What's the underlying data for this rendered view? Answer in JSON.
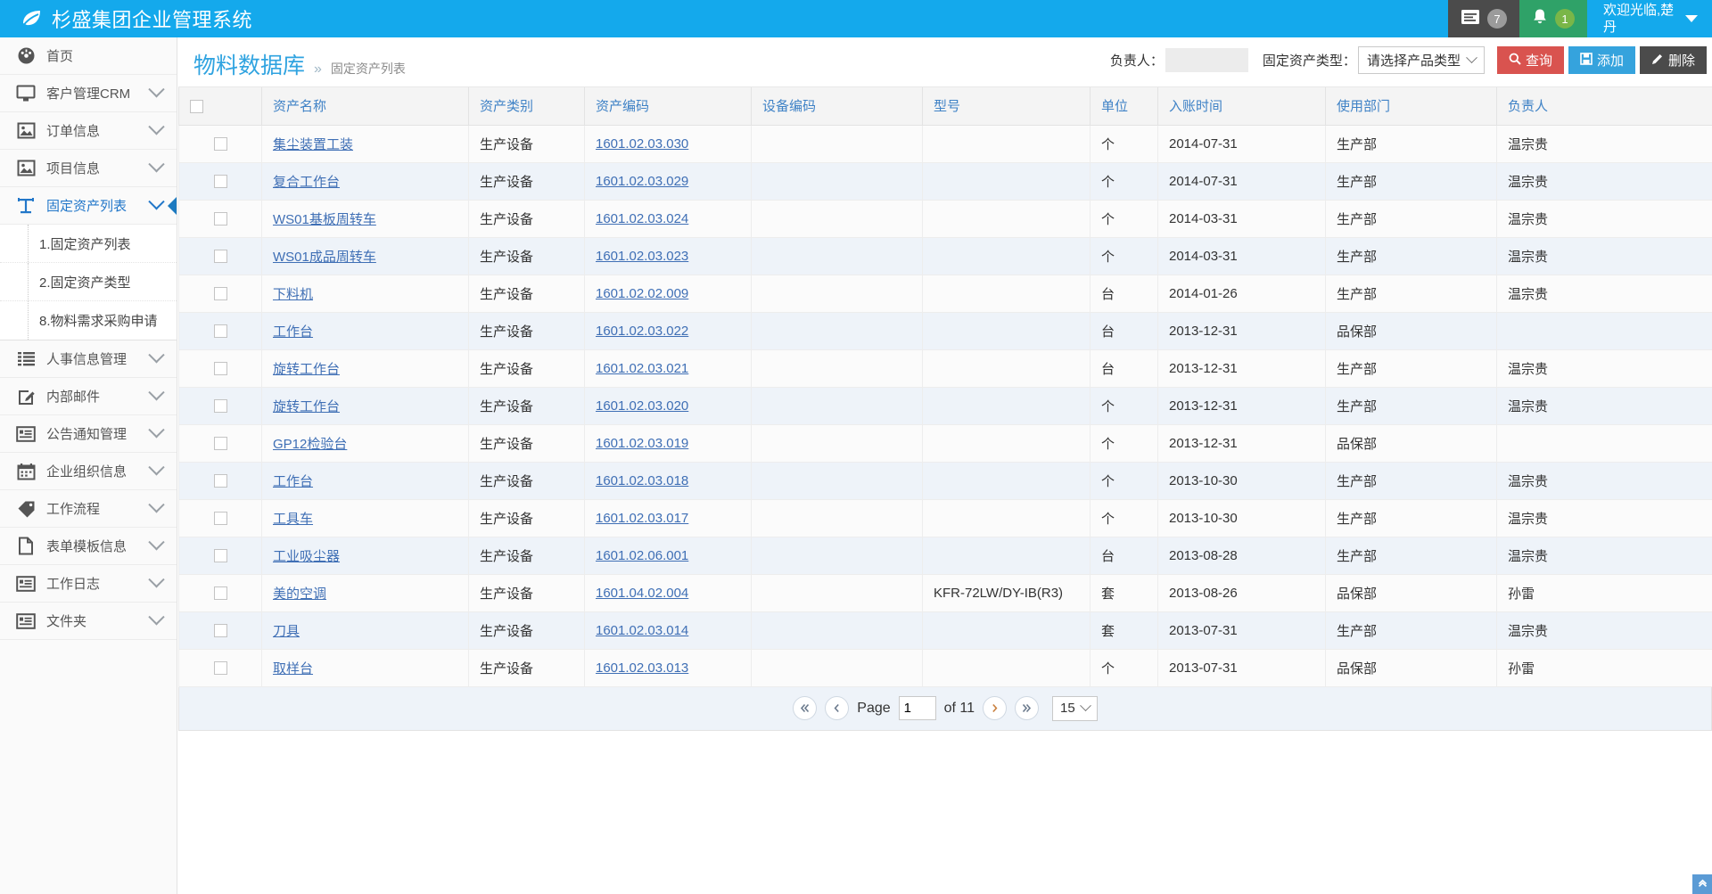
{
  "topbar": {
    "brand": "杉盛集团企业管理系统",
    "leaf_icon": "leaf-icon",
    "messages": {
      "icon": "messages-icon",
      "count": "7"
    },
    "notifications": {
      "icon": "bell-icon",
      "count": "1"
    },
    "welcome": "欢迎光临,楚丹",
    "welcome_caret": "chevron-down-icon"
  },
  "sidebar": {
    "items": [
      {
        "label": "首页",
        "icon": "dashboard-icon",
        "chevron": false,
        "active": false
      },
      {
        "label": "客户管理CRM",
        "icon": "monitor-icon",
        "chevron": true,
        "active": false
      },
      {
        "label": "订单信息",
        "icon": "image-icon",
        "chevron": true,
        "active": false
      },
      {
        "label": "项目信息",
        "icon": "image-icon",
        "chevron": true,
        "active": false
      },
      {
        "label": "固定资产列表",
        "icon": "text-tool-icon",
        "chevron": true,
        "active": true
      },
      {
        "label": "人事信息管理",
        "icon": "list-icon",
        "chevron": true,
        "active": false
      },
      {
        "label": "内部邮件",
        "icon": "edit-icon",
        "chevron": true,
        "active": false
      },
      {
        "label": "公告通知管理",
        "icon": "notice-icon",
        "chevron": true,
        "active": false
      },
      {
        "label": "企业组织信息",
        "icon": "calendar-icon",
        "chevron": true,
        "active": false
      },
      {
        "label": "工作流程",
        "icon": "tag-icon",
        "chevron": true,
        "active": false
      },
      {
        "label": "表单模板信息",
        "icon": "file-icon",
        "chevron": true,
        "active": false
      },
      {
        "label": "工作日志",
        "icon": "notice-icon",
        "chevron": true,
        "active": false
      },
      {
        "label": "文件夹",
        "icon": "notice-icon",
        "chevron": true,
        "active": false
      }
    ],
    "subitems": [
      {
        "label": "1.固定资产列表"
      },
      {
        "label": "2.固定资产类型"
      },
      {
        "label": "8.物料需求采购申请"
      }
    ]
  },
  "page": {
    "title": "物料数据库",
    "crumb_sep": "»",
    "crumb": "固定资产列表"
  },
  "toolbar": {
    "owner_label": "负责人：",
    "owner_value": "",
    "owner_placeholder": "",
    "type_label": "固定资产类型：",
    "type_selected": "请选择产品类型",
    "type_caret": "chevron-down-icon",
    "search_label": "查询",
    "search_icon": "search-icon",
    "add_label": "添加",
    "add_icon": "save-icon",
    "delete_label": "删除",
    "delete_icon": "pencil-icon"
  },
  "table": {
    "columns": [
      "",
      "资产名称",
      "资产类别",
      "资产编码",
      "设备编码",
      "型号",
      "单位",
      "入账时间",
      "使用部门",
      "负责人"
    ],
    "rows": [
      {
        "name": "集尘装置工装",
        "cat": "生产设备",
        "code": "1601.02.03.030",
        "dev": "",
        "model": "",
        "unit": "个",
        "date": "2014-07-31",
        "dept": "生产部",
        "owner": "温宗贵"
      },
      {
        "name": "复合工作台",
        "cat": "生产设备",
        "code": "1601.02.03.029",
        "dev": "",
        "model": "",
        "unit": "个",
        "date": "2014-07-31",
        "dept": "生产部",
        "owner": "温宗贵"
      },
      {
        "name": "WS01基板周转车",
        "cat": "生产设备",
        "code": "1601.02.03.024",
        "dev": "",
        "model": "",
        "unit": "个",
        "date": "2014-03-31",
        "dept": "生产部",
        "owner": "温宗贵"
      },
      {
        "name": "WS01成品周转车",
        "cat": "生产设备",
        "code": "1601.02.03.023",
        "dev": "",
        "model": "",
        "unit": "个",
        "date": "2014-03-31",
        "dept": "生产部",
        "owner": "温宗贵"
      },
      {
        "name": "下料机",
        "cat": "生产设备",
        "code": "1601.02.02.009",
        "dev": "",
        "model": "",
        "unit": "台",
        "date": "2014-01-26",
        "dept": "生产部",
        "owner": "温宗贵"
      },
      {
        "name": "工作台",
        "cat": "生产设备",
        "code": "1601.02.03.022",
        "dev": "",
        "model": "",
        "unit": "台",
        "date": "2013-12-31",
        "dept": "品保部",
        "owner": ""
      },
      {
        "name": "旋转工作台",
        "cat": "生产设备",
        "code": "1601.02.03.021",
        "dev": "",
        "model": "",
        "unit": "台",
        "date": "2013-12-31",
        "dept": "生产部",
        "owner": "温宗贵"
      },
      {
        "name": "旋转工作台",
        "cat": "生产设备",
        "code": "1601.02.03.020",
        "dev": "",
        "model": "",
        "unit": "个",
        "date": "2013-12-31",
        "dept": "生产部",
        "owner": "温宗贵"
      },
      {
        "name": "GP12检验台",
        "cat": "生产设备",
        "code": "1601.02.03.019",
        "dev": "",
        "model": "",
        "unit": "个",
        "date": "2013-12-31",
        "dept": "品保部",
        "owner": ""
      },
      {
        "name": "工作台",
        "cat": "生产设备",
        "code": "1601.02.03.018",
        "dev": "",
        "model": "",
        "unit": "个",
        "date": "2013-10-30",
        "dept": "生产部",
        "owner": "温宗贵"
      },
      {
        "name": "工具车",
        "cat": "生产设备",
        "code": "1601.02.03.017",
        "dev": "",
        "model": "",
        "unit": "个",
        "date": "2013-10-30",
        "dept": "生产部",
        "owner": "温宗贵"
      },
      {
        "name": "工业吸尘器",
        "cat": "生产设备",
        "code": "1601.02.06.001",
        "dev": "",
        "model": "",
        "unit": "台",
        "date": "2013-08-28",
        "dept": "生产部",
        "owner": "温宗贵"
      },
      {
        "name": "美的空调",
        "cat": "生产设备",
        "code": "1601.04.02.004",
        "dev": "",
        "model": "KFR-72LW/DY-IB(R3)",
        "unit": "套",
        "date": "2013-08-26",
        "dept": "品保部",
        "owner": "孙雷"
      },
      {
        "name": "刀具",
        "cat": "生产设备",
        "code": "1601.02.03.014",
        "dev": "",
        "model": "",
        "unit": "套",
        "date": "2013-07-31",
        "dept": "生产部",
        "owner": "温宗贵"
      },
      {
        "name": "取样台",
        "cat": "生产设备",
        "code": "1601.02.03.013",
        "dev": "",
        "model": "",
        "unit": "个",
        "date": "2013-07-31",
        "dept": "品保部",
        "owner": "孙雷"
      }
    ]
  },
  "pager": {
    "first_icon": "double-chevron-left-icon",
    "prev_icon": "chevron-left-icon",
    "page_label": "Page",
    "page_value": "1",
    "of_label": "of 11",
    "next_icon": "chevron-right-icon",
    "last_icon": "double-chevron-right-icon",
    "page_size": "15",
    "page_size_caret": "chevron-down-icon"
  },
  "to_top": {
    "icon": "chevron-up-icon"
  },
  "colors": {
    "brand_blue": "#14a9ec",
    "header_link": "#3f82c6",
    "search_red": "#d9534f",
    "add_blue": "#35a3dd",
    "delete_dark": "#4b4b4b",
    "notify_green": "#2fa268"
  }
}
